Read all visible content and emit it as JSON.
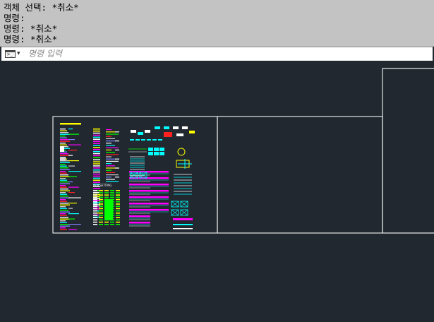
{
  "history": {
    "lines": [
      "객체 선택: *취소*",
      "명령:",
      "명령: *취소*",
      "명령: *취소*"
    ]
  },
  "command": {
    "icon": "terminal-icon",
    "dropdown_icon": "chevron-down-icon",
    "placeholder": "명령 입력"
  },
  "drawing": {
    "pen_setting_label": "PEN SETTING"
  },
  "colors": {
    "background": "#212830",
    "history_bg": "#c3c3c3",
    "frame": "#e6e6e6",
    "yellow": "#ffff00",
    "cyan": "#00ffff",
    "magenta": "#ff00ff",
    "green": "#00ff00",
    "red": "#ff2020"
  }
}
